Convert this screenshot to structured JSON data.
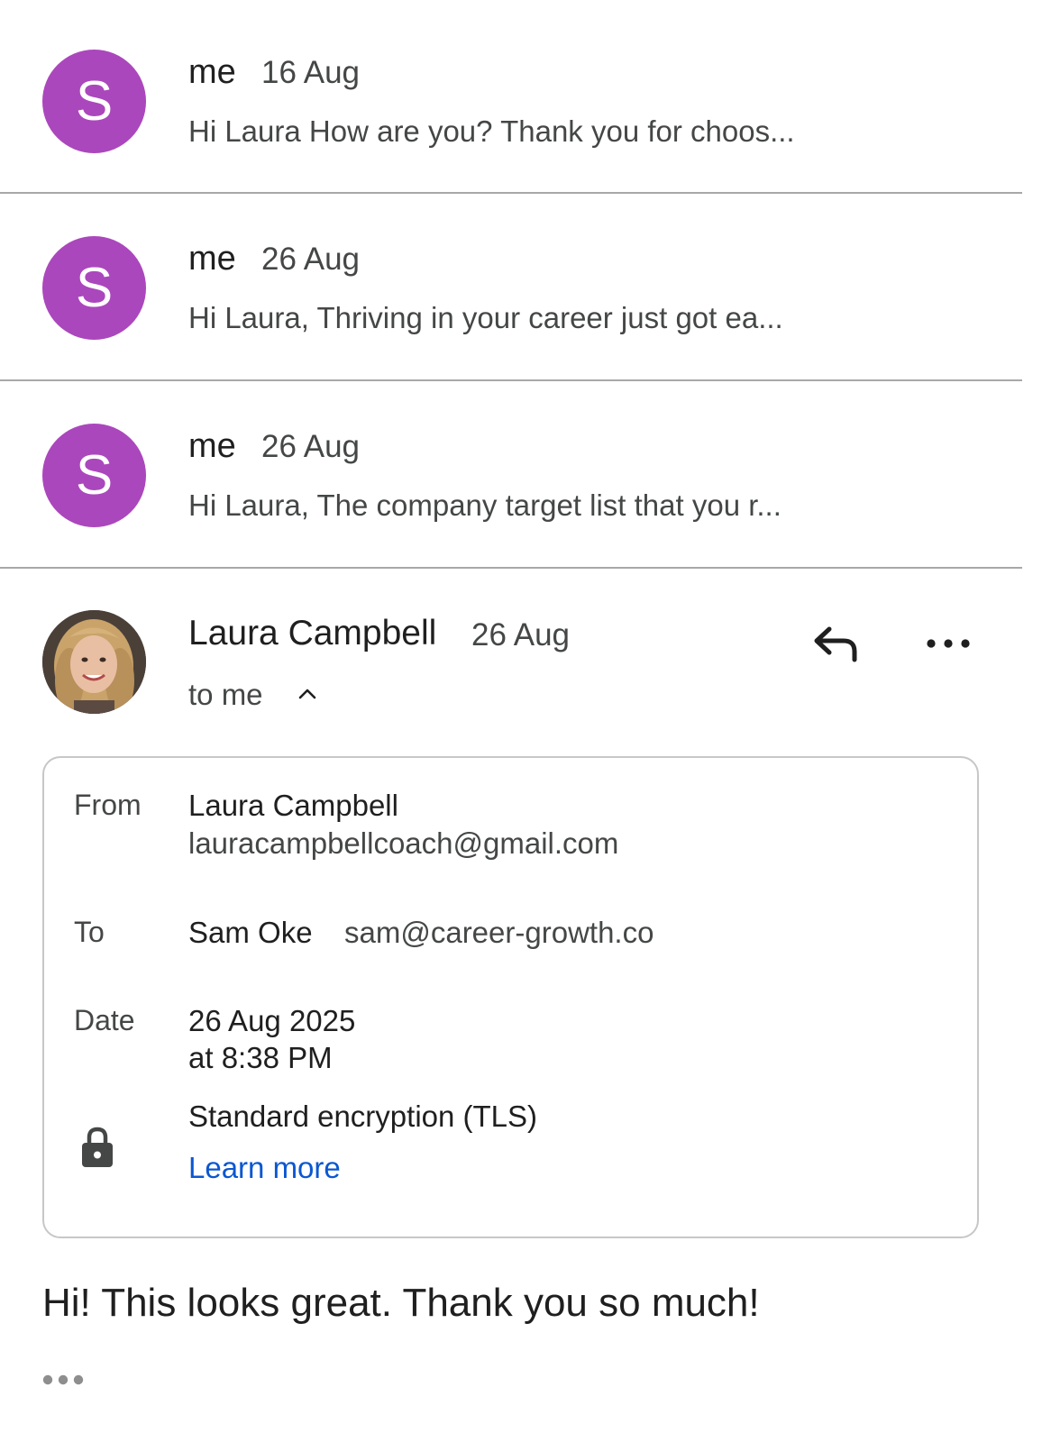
{
  "messages": [
    {
      "avatar_letter": "S",
      "sender": "me",
      "date": "16 Aug",
      "snippet": "Hi Laura How are you? Thank you for choos..."
    },
    {
      "avatar_letter": "S",
      "sender": "me",
      "date": "26 Aug",
      "snippet": "Hi Laura, Thriving in your career just got ea..."
    },
    {
      "avatar_letter": "S",
      "sender": "me",
      "date": "26 Aug",
      "snippet": "Hi Laura, The company target list that you r..."
    }
  ],
  "expanded": {
    "sender": "Laura Campbell",
    "date": "26 Aug",
    "to_line": "to me",
    "details": {
      "from_label": "From",
      "from_name": "Laura Campbell",
      "from_email": "lauracampbellcoach@gmail.com",
      "to_label": "To",
      "to_name": "Sam Oke",
      "to_email": "sam@career-growth.co",
      "date_label": "Date",
      "date_line1": "26 Aug 2025",
      "date_line2": "at 8:38 PM",
      "encryption": "Standard encryption (TLS)",
      "learn_more": "Learn more"
    },
    "body": "Hi! This looks great. Thank you so much!"
  },
  "icons": {
    "reply": "reply-icon",
    "more": "more-horizontal-icon",
    "chevron": "chevron-up-icon",
    "lock": "lock-icon",
    "trimmed_content": "more-horizontal-icon"
  },
  "colors": {
    "avatar_bg": "#ab47bc",
    "link": "#0b57d0",
    "divider": "#a8a8a8"
  }
}
